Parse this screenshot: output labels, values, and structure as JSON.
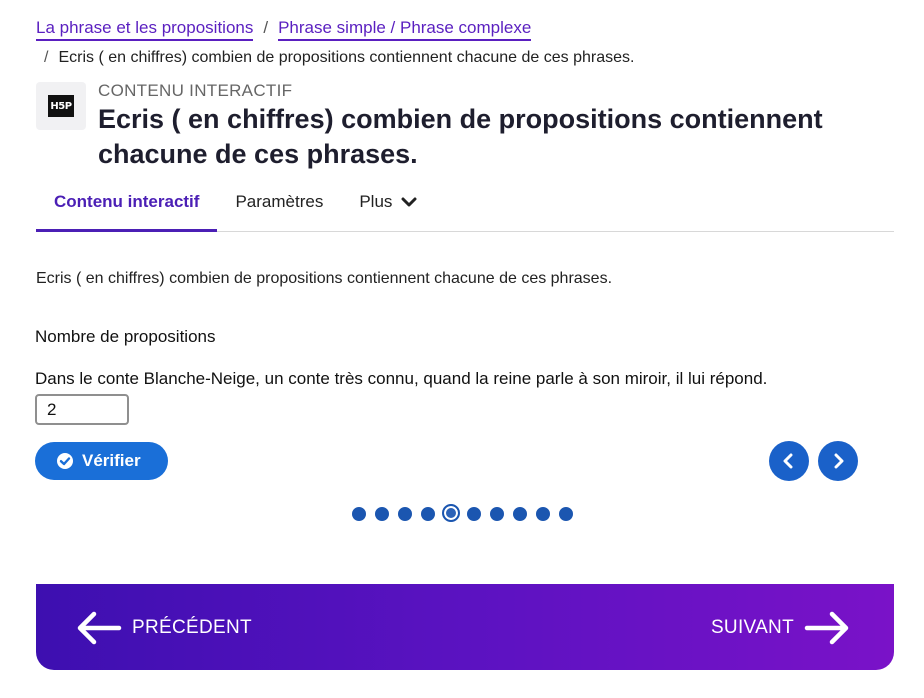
{
  "breadcrumb": {
    "items": [
      "La phrase et les propositions",
      "Phrase simple / Phrase complexe"
    ],
    "separator": "/",
    "current": "Ecris ( en chiffres) combien de propositions contiennent chacune de ces phrases."
  },
  "header": {
    "logo_text": "H5P",
    "kicker": "CONTENU INTERACTIF",
    "title": "Ecris ( en chiffres) combien de propositions contiennent chacune de ces phrases."
  },
  "tabs": [
    {
      "label": "Contenu interactif",
      "active": true
    },
    {
      "label": "Paramètres",
      "active": false
    },
    {
      "label": "Plus",
      "active": false
    }
  ],
  "content": {
    "task": "Ecris ( en chiffres) combien de propositions contiennent chacune de ces phrases.",
    "question_title": "Nombre de propositions",
    "question_text": "Dans le conte Blanche-Neige, un conte très connu, quand la reine parle à son miroir, il lui répond.",
    "answer_value": "2",
    "verify_label": "Vérifier"
  },
  "pager": {
    "total": 10,
    "current_index": 4
  },
  "footer": {
    "prev_label": "PRÉCÉDENT",
    "next_label": "SUIVANT"
  },
  "colors": {
    "accent": "#4b1fb5",
    "button_blue": "#1a6fd8",
    "footer_gradient_start": "#3d0fb0",
    "footer_gradient_end": "#7a12c8"
  },
  "icons": {
    "verify": "check-circle-icon",
    "prev": "chevron-left-icon",
    "next": "chevron-right-icon",
    "footer_prev": "arrow-left-icon",
    "footer_next": "arrow-right-icon",
    "tab_more": "chevron-down-icon"
  }
}
